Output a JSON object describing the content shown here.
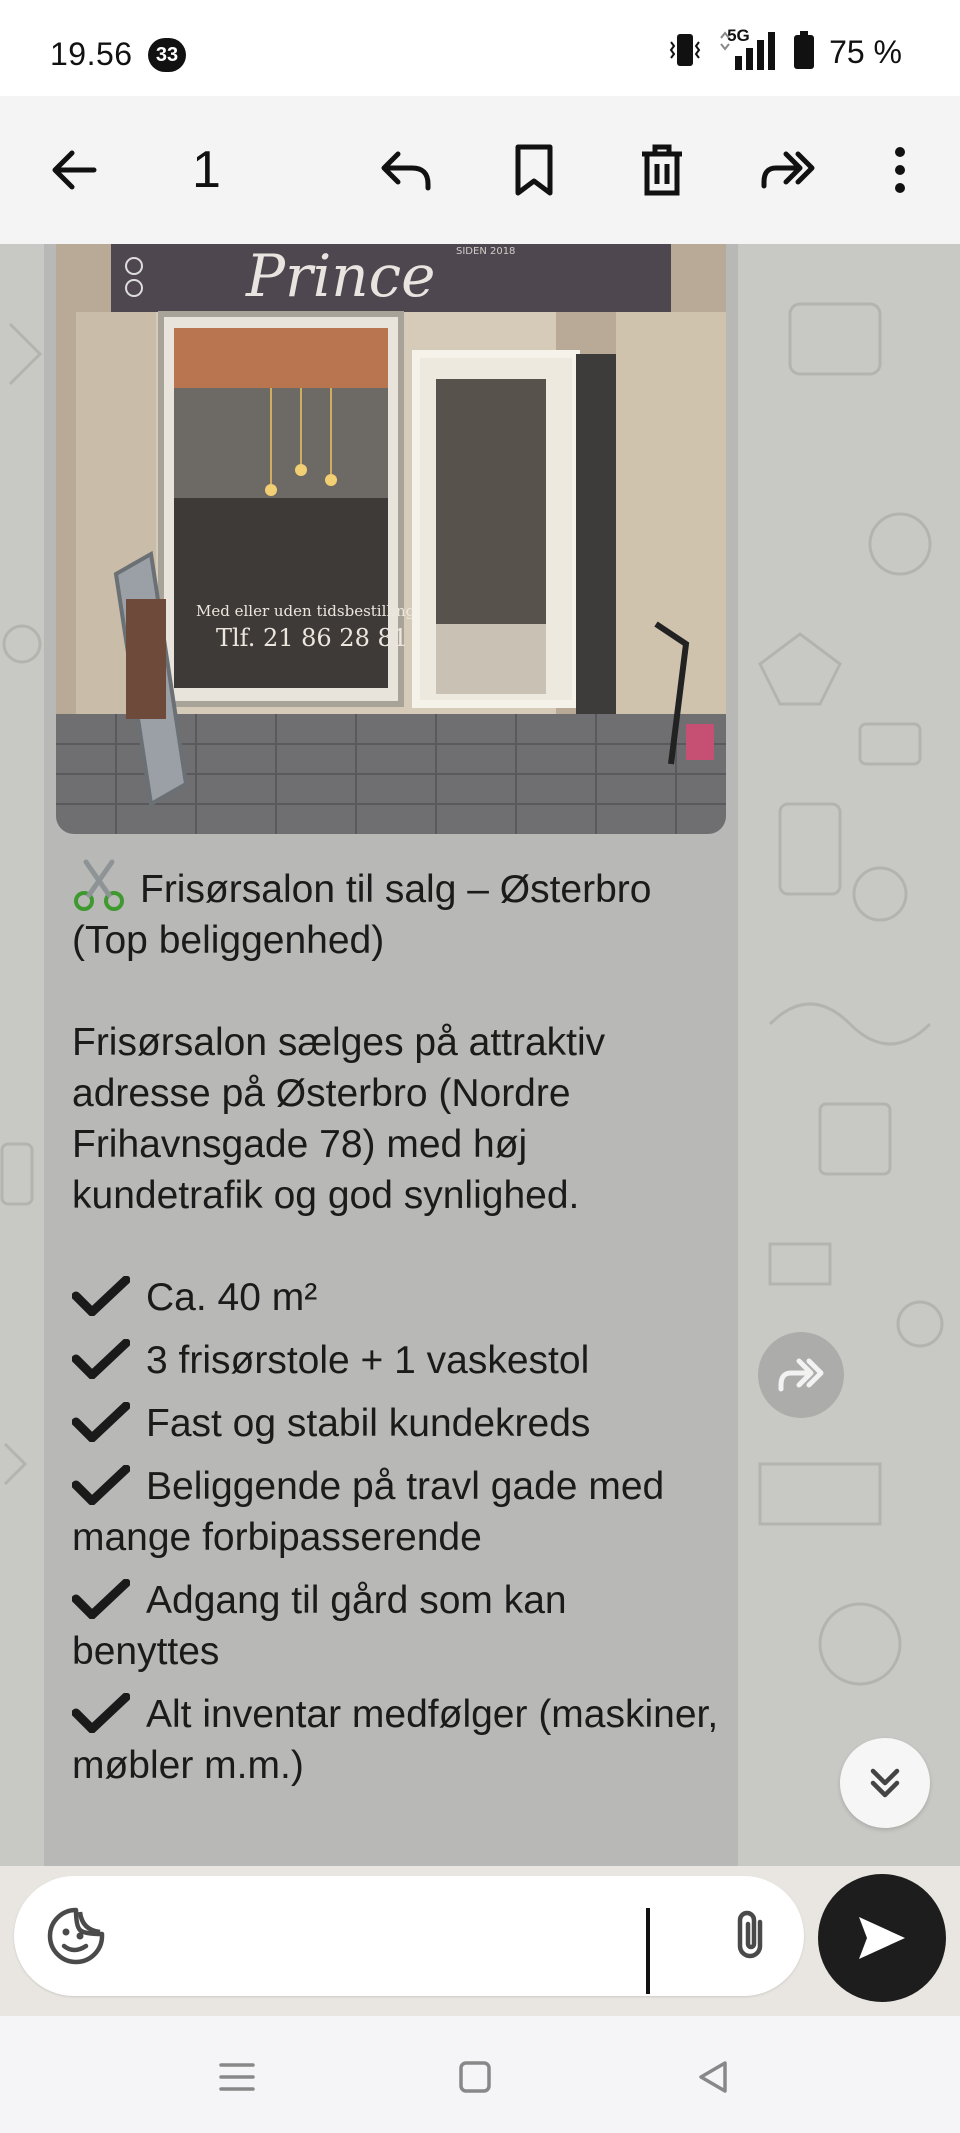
{
  "status_bar": {
    "time": "19.56",
    "notification_count": "33",
    "network": "5G",
    "battery": "75 %"
  },
  "toolbar": {
    "selected_count": "1",
    "icons": [
      "back-arrow-icon",
      "reply-icon",
      "bookmark-icon",
      "delete-icon",
      "forward-icon",
      "more-vert-icon"
    ]
  },
  "photo": {
    "sign_text": "Prince",
    "sign_small": "SIDEN 2018",
    "window_line1": "Med eller uden tidsbestilling",
    "window_line2": "Tlf. 21 86 28 81"
  },
  "message": {
    "title": "Frisørsalon til salg – Østerbro (Top beliggenhed)",
    "paragraph": "Frisørsalon sælges på attraktiv adresse på Østerbro (Nordre Frihavnsgade 78) med høj kundetrafik og god synlighed.",
    "checklist": [
      "Ca. 40 m²",
      "3 frisørstole + 1 vaskestol",
      "Fast og stabil kundekreds",
      "Beliggende på travl gade med mange forbipasserende",
      "Adgang til gård som kan benyttes",
      "Alt inventar medfølger (maskiner, møbler m.m.)"
    ]
  },
  "colors": {
    "toolbar_bg": "#f4f4f4",
    "bubble_bg": "#b8b8b7",
    "send_button": "#1d1d1d"
  }
}
